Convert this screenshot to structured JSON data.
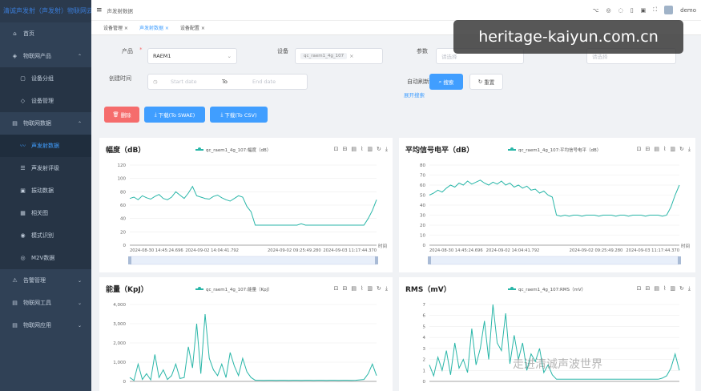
{
  "app": {
    "logo_text": "清诚声发射（声发射）物联网云",
    "breadcrumb": "声发射数据",
    "user": "demo"
  },
  "sidebar": {
    "items": [
      {
        "label": "首页",
        "icon": "home-icon",
        "glyph": "⌂",
        "sub": false
      },
      {
        "label": "物联网产品",
        "icon": "product-icon",
        "glyph": "◈",
        "sub": false,
        "arrow": "⌃"
      },
      {
        "label": "设备分组",
        "icon": "group-icon",
        "glyph": "▢",
        "sub": true
      },
      {
        "label": "设备管理",
        "icon": "device-icon",
        "glyph": "◇",
        "sub": true
      },
      {
        "label": "物联网数据",
        "icon": "data-icon",
        "glyph": "▤",
        "sub": false,
        "arrow": "⌃"
      },
      {
        "label": "声发射数据",
        "icon": "ae-data-icon",
        "glyph": "〰",
        "sub": true,
        "active": true
      },
      {
        "label": "声发射评级",
        "icon": "rating-icon",
        "glyph": "☰",
        "sub": true
      },
      {
        "label": "振动数据",
        "icon": "vibration-icon",
        "glyph": "▣",
        "sub": true
      },
      {
        "label": "相关图",
        "icon": "correlation-icon",
        "glyph": "▦",
        "sub": true
      },
      {
        "label": "模式识别",
        "icon": "pattern-icon",
        "glyph": "◉",
        "sub": true
      },
      {
        "label": "M2V数据",
        "icon": "m2v-icon",
        "glyph": "◎",
        "sub": true
      },
      {
        "label": "告警管理",
        "icon": "alarm-icon",
        "glyph": "⚠",
        "sub": false,
        "arrow": "⌄"
      },
      {
        "label": "物联网工具",
        "icon": "tool-icon",
        "glyph": "▤",
        "sub": false,
        "arrow": "⌄"
      },
      {
        "label": "物联网应用",
        "icon": "app-icon",
        "glyph": "▤",
        "sub": false,
        "arrow": "⌄"
      }
    ]
  },
  "tabs": [
    {
      "label": "设备管理"
    },
    {
      "label": "声发射数据",
      "active": true
    },
    {
      "label": "设备配置"
    }
  ],
  "form": {
    "product_label": "产品",
    "product_value": "RAEM1",
    "device_label": "设备",
    "device_chip": "qc_raem1_4g_107",
    "param_label": "参数",
    "param_placeholder": "请选择",
    "sort_placeholder": "请选择",
    "time_label": "创建时间",
    "start_placeholder": "Start date",
    "to_text": "To",
    "end_placeholder": "End date",
    "auto_refresh_label": "自动刷新",
    "search_label": "搜索",
    "reset_label": "重置",
    "expand_label": "展开搜索",
    "delete_label": "删除",
    "download_swae_label": "下载(To SWAE)",
    "download_csv_label": "下载(To CSV)"
  },
  "charts_text": {
    "xaxis_name": "时间",
    "x_ticks": [
      "2024-08-30 14:45:24.696",
      "2024-09-02 14:04:41.792",
      "2024-09-02 09:25:49.280",
      "2024-09-03 11:17:44.370"
    ]
  },
  "chart_data": [
    {
      "type": "line",
      "title": "幅度（dB）",
      "legend": "qc_raem1_4g_107:幅度（dB）",
      "ylim": [
        0,
        120
      ],
      "yticks": [
        0,
        20,
        40,
        60,
        80,
        100,
        120
      ],
      "color": "#29b6a8",
      "series": [
        {
          "name": "qc_raem1_4g_107:幅度（dB）",
          "values": [
            70,
            72,
            68,
            74,
            71,
            69,
            73,
            76,
            70,
            68,
            72,
            80,
            75,
            70,
            78,
            88,
            74,
            72,
            70,
            69,
            73,
            75,
            71,
            68,
            66,
            70,
            74,
            72,
            58,
            50,
            30,
            30,
            30,
            30,
            30,
            30,
            30,
            30,
            30,
            30,
            30,
            32,
            30,
            30,
            30,
            30,
            30,
            30,
            30,
            30,
            30,
            30,
            30,
            30,
            30,
            30,
            30,
            40,
            52,
            68
          ]
        }
      ]
    },
    {
      "type": "line",
      "title": "平均信号电平（dB）",
      "legend": "qc_raem1_4g_107:平均信号电平（dB）",
      "ylim": [
        0,
        80
      ],
      "yticks": [
        0,
        10,
        20,
        30,
        40,
        50,
        60,
        70,
        80
      ],
      "color": "#29b6a8",
      "series": [
        {
          "name": "qc_raem1_4g_107:平均信号电平（dB）",
          "values": [
            50,
            52,
            55,
            53,
            57,
            60,
            58,
            62,
            60,
            64,
            61,
            63,
            65,
            62,
            60,
            63,
            61,
            64,
            60,
            62,
            58,
            60,
            57,
            59,
            55,
            56,
            52,
            54,
            50,
            48,
            30,
            29,
            30,
            29,
            30,
            30,
            29,
            30,
            30,
            30,
            29,
            30,
            30,
            30,
            29,
            30,
            30,
            29,
            30,
            30,
            30,
            29,
            30,
            30,
            30,
            29,
            30,
            38,
            50,
            60
          ]
        }
      ]
    },
    {
      "type": "line",
      "title": "能量（KpJ）",
      "legend": "qc_raem1_4g_107:能量（KpJ）",
      "ylim": [
        0,
        4000
      ],
      "yticks": [
        0,
        1000,
        2000,
        3000,
        4000
      ],
      "color": "#29b6a8",
      "series": [
        {
          "name": "qc_raem1_4g_107:能量（KpJ）",
          "values": [
            200,
            50,
            900,
            100,
            400,
            80,
            1400,
            200,
            600,
            100,
            300,
            900,
            150,
            200,
            1800,
            700,
            3000,
            400,
            3500,
            1200,
            600,
            300,
            900,
            200,
            1500,
            800,
            300,
            1200,
            500,
            200,
            60,
            60,
            50,
            60,
            60,
            50,
            60,
            60,
            50,
            60,
            60,
            50,
            60,
            60,
            50,
            60,
            60,
            50,
            60,
            60,
            50,
            60,
            60,
            50,
            60,
            80,
            100,
            400,
            900,
            300
          ]
        }
      ]
    },
    {
      "type": "line",
      "title": "RMS（mV）",
      "legend": "qc_raem1_4g_107:RMS（mV）",
      "ylim": [
        0,
        7
      ],
      "yticks": [
        0,
        1,
        2,
        3,
        4,
        5,
        6,
        7
      ],
      "color": "#29b6a8",
      "series": [
        {
          "name": "qc_raem1_4g_107:RMS（mV）",
          "values": [
            1.5,
            0.5,
            2.2,
            1.0,
            2.8,
            0.6,
            3.5,
            1.2,
            2.0,
            0.8,
            4.8,
            1.5,
            3.0,
            5.5,
            2.0,
            7.0,
            3.5,
            2.8,
            6.2,
            1.6,
            4.2,
            2.0,
            3.5,
            1.0,
            2.5,
            1.8,
            3.0,
            0.8,
            1.5,
            0.6,
            0.2,
            0.2,
            0.2,
            0.2,
            0.2,
            0.2,
            0.2,
            0.2,
            0.2,
            0.2,
            0.2,
            0.2,
            0.2,
            0.2,
            0.2,
            0.2,
            0.2,
            0.2,
            0.2,
            0.2,
            0.2,
            0.2,
            0.2,
            0.2,
            0.2,
            0.3,
            0.5,
            1.2,
            2.5,
            1.0
          ]
        }
      ]
    }
  ],
  "watermark": {
    "text": "heritage-kaiyun.com.cn",
    "overlay_text": "走进清诚声波世界"
  }
}
